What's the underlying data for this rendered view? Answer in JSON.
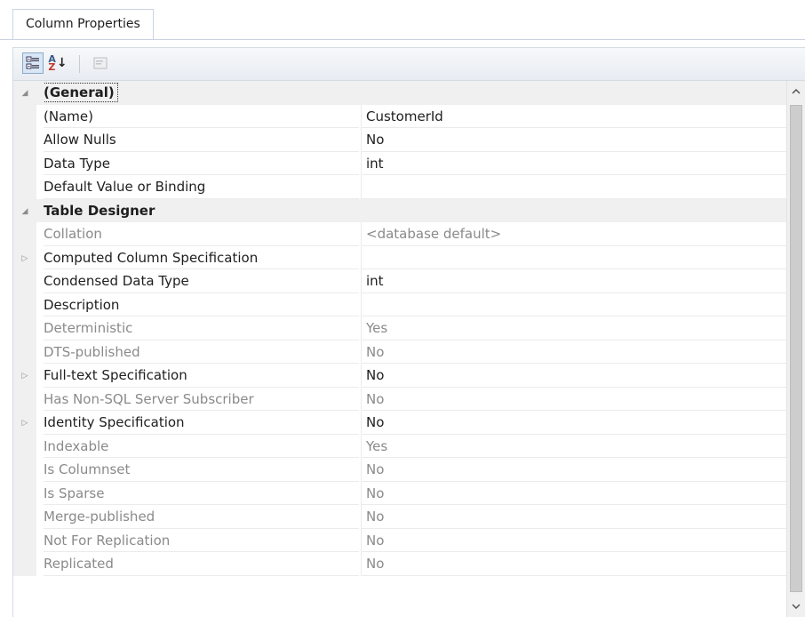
{
  "tab": {
    "label": "Column Properties"
  },
  "toolbar": {
    "categorized": {
      "icon": "categorized-icon"
    },
    "alphabetical": {
      "icon": "alphabetical-sort-icon",
      "glyph_top": "A",
      "glyph_bottom": "Z"
    },
    "property_pages": {
      "icon": "property-pages-icon"
    }
  },
  "grid": {
    "rows": [
      {
        "kind": "category",
        "expander": "◢",
        "name": "(General)",
        "selected": true
      },
      {
        "kind": "prop",
        "name": "(Name)",
        "value": "CustomerId",
        "disabled": false
      },
      {
        "kind": "prop",
        "name": "Allow Nulls",
        "value": "No",
        "disabled": false
      },
      {
        "kind": "prop",
        "name": "Data Type",
        "value": "int",
        "disabled": false
      },
      {
        "kind": "prop",
        "name": "Default Value or Binding",
        "value": "",
        "disabled": false
      },
      {
        "kind": "category",
        "expander": "◢",
        "name": "Table Designer"
      },
      {
        "kind": "prop",
        "name": "Collation",
        "value": "<database default>",
        "disabled": true
      },
      {
        "kind": "prop",
        "name": "Computed Column Specification",
        "value": "",
        "disabled": false,
        "expander": "▷"
      },
      {
        "kind": "prop",
        "name": "Condensed Data Type",
        "value": "int",
        "disabled": false
      },
      {
        "kind": "prop",
        "name": "Description",
        "value": "",
        "disabled": false
      },
      {
        "kind": "prop",
        "name": "Deterministic",
        "value": "Yes",
        "disabled": true
      },
      {
        "kind": "prop",
        "name": "DTS-published",
        "value": "No",
        "disabled": true
      },
      {
        "kind": "prop",
        "name": "Full-text Specification",
        "value": "No",
        "disabled": false,
        "expander": "▷"
      },
      {
        "kind": "prop",
        "name": "Has Non-SQL Server Subscriber",
        "value": "No",
        "disabled": true
      },
      {
        "kind": "prop",
        "name": "Identity Specification",
        "value": "No",
        "disabled": false,
        "expander": "▷"
      },
      {
        "kind": "prop",
        "name": "Indexable",
        "value": "Yes",
        "disabled": true
      },
      {
        "kind": "prop",
        "name": "Is Columnset",
        "value": "No",
        "disabled": true
      },
      {
        "kind": "prop",
        "name": "Is Sparse",
        "value": "No",
        "disabled": true
      },
      {
        "kind": "prop",
        "name": "Merge-published",
        "value": "No",
        "disabled": true
      },
      {
        "kind": "prop",
        "name": "Not For Replication",
        "value": "No",
        "disabled": true
      },
      {
        "kind": "prop",
        "name": "Replicated",
        "value": "No",
        "disabled": true
      }
    ]
  },
  "scrollbar": {
    "up_icon": "chevron-up-icon",
    "down_icon": "chevron-down-icon"
  },
  "colors": {
    "disabled_text": "#8a8a8a",
    "gutter": "#f0f0f0",
    "grid_line": "#ebebeb"
  }
}
